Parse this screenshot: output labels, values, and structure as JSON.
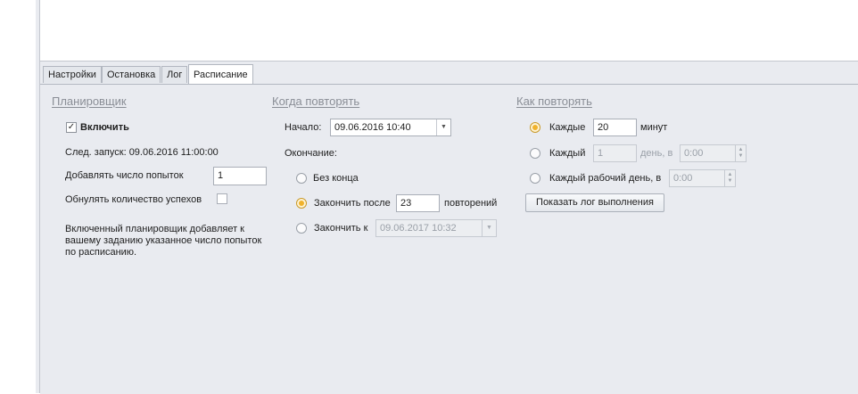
{
  "tabs": [
    {
      "label": "Настройки"
    },
    {
      "label": "Остановка"
    },
    {
      "label": "Лог"
    },
    {
      "label": "Расписание"
    }
  ],
  "scheduler": {
    "heading": "Планировщик",
    "enable_label": "Включить",
    "enable_checked": true,
    "next_run": "След. запуск: 09.06.2016 11:00:00",
    "add_attempts_label": "Добавлять число попыток",
    "add_attempts_value": "1",
    "reset_success_label": "Обнулять количество успехов",
    "reset_success_checked": false,
    "description": "Включенный планировщик добавляет к вашему заданию указанное число попыток по расписанию."
  },
  "when": {
    "heading": "Когда повторять",
    "start_label": "Начало:",
    "start_value": "09.06.2016 10:40",
    "end_label": "Окончание:",
    "no_end_label": "Без конца",
    "end_after_label": "Закончить после",
    "end_after_value": "23",
    "repeats_label": "повторений",
    "end_at_label": "Закончить к",
    "end_at_value": "09.06.2017 10:32",
    "selected": "end_after"
  },
  "how": {
    "heading": "Как повторять",
    "every_label": "Каждые",
    "every_value": "20",
    "minutes_label": "минут",
    "each_day_label": "Каждый",
    "each_day_value": "1",
    "day_at_label": "день, в",
    "day_time_value": "0:00",
    "workday_label": "Каждый рабочий день, в",
    "workday_time_value": "0:00",
    "selected": "every_minutes",
    "show_log_button": "Показать лог выполнения"
  },
  "colors": {
    "panel_bg": "#e9ebf0",
    "radio_accent": "#f0b22c",
    "section_heading": "#8a8e96"
  }
}
